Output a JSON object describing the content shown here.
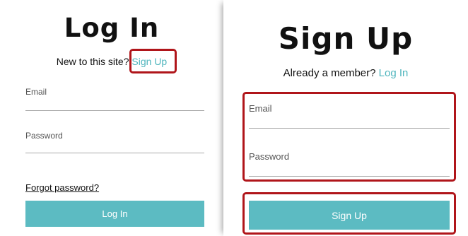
{
  "colors": {
    "accent": "#5cbbc2",
    "link": "#4fb5bd",
    "highlight": "#b0151a"
  },
  "login": {
    "title": "Log In",
    "prompt_text": "New to this site?",
    "prompt_link": "Sign Up",
    "email_label": "Email",
    "password_label": "Password",
    "forgot_link": "Forgot password?",
    "submit_label": "Log In"
  },
  "signup": {
    "title": "Sign Up",
    "prompt_text": "Already a member?",
    "prompt_link": "Log In",
    "email_label": "Email",
    "password_label": "Password",
    "submit_label": "Sign Up"
  }
}
